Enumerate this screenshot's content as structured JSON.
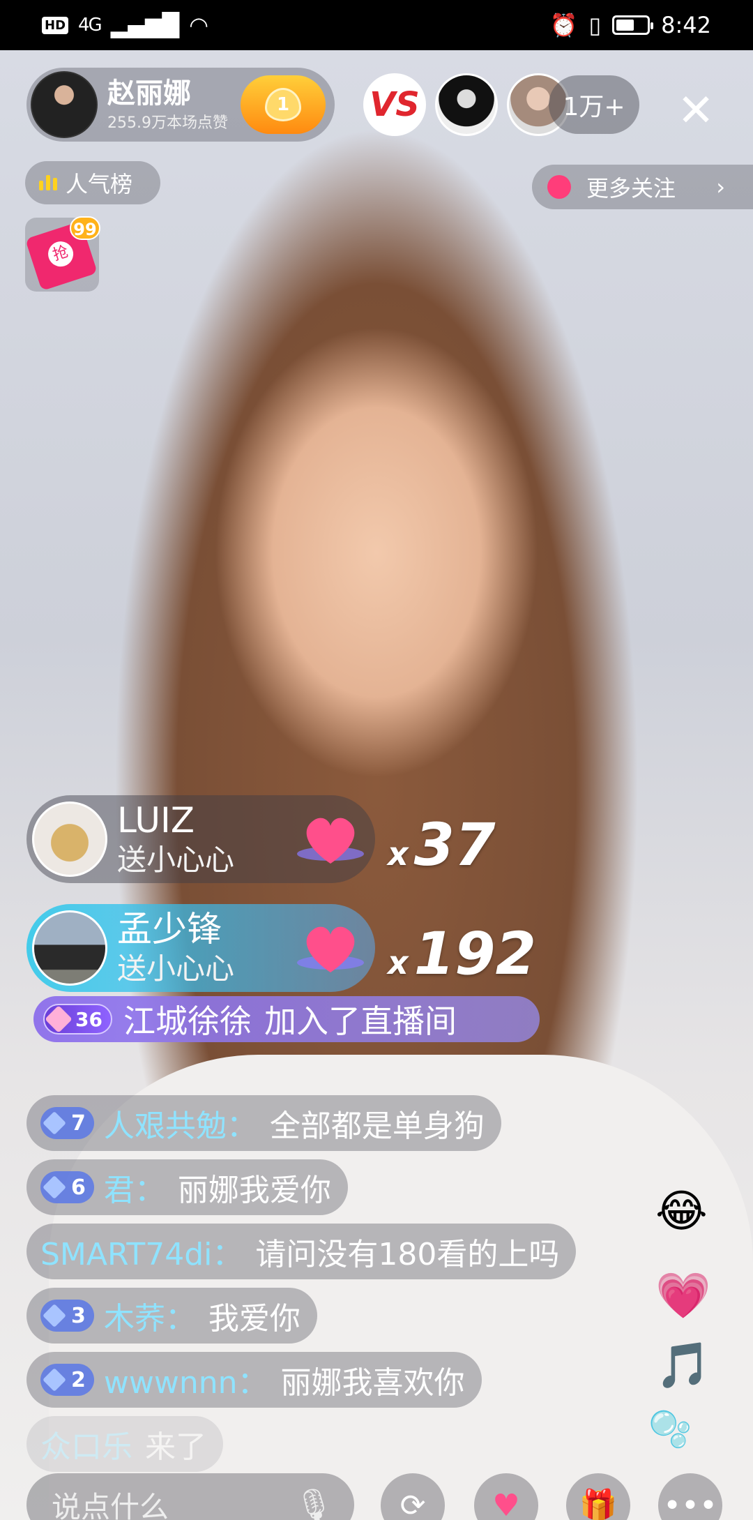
{
  "status_bar": {
    "hd": "HD",
    "network": "4G",
    "time": "8:42",
    "battery_level": 0.6
  },
  "host": {
    "name": "赵丽娜",
    "likes": "255.9万本场点赞",
    "follow_level": "1"
  },
  "viewers": {
    "vs_label": "VS",
    "count": "1万+"
  },
  "rank": {
    "label": "人气榜"
  },
  "more_follow": {
    "label": "更多关注"
  },
  "red_packet": {
    "badge": "99"
  },
  "gifts": [
    {
      "name": "LUIZ",
      "action": "送小心心",
      "x": "x",
      "count": "37"
    },
    {
      "name": "孟少锋",
      "action": "送小心心",
      "x": "x",
      "count": "192"
    }
  ],
  "join": {
    "level": "36",
    "user": "江城徐徐",
    "text": "加入了直播间"
  },
  "chat": [
    {
      "level": "7",
      "user": "人艰共勉：",
      "message": "全部都是单身狗"
    },
    {
      "level": "6",
      "user": "君：",
      "message": "丽娜我爱你"
    },
    {
      "level": "",
      "user": "SMART74di：",
      "message": "请问没有180看的上吗"
    },
    {
      "level": "3",
      "user": "木荞：",
      "message": "我爱你"
    },
    {
      "level": "2",
      "user": "wwwnnn：",
      "message": "丽娜我喜欢你"
    },
    {
      "level": "",
      "user": "众口乐",
      "message": "来了"
    }
  ],
  "input": {
    "placeholder": "说点什么"
  },
  "colors": {
    "gift_heart": "#ff4f8b",
    "chat_user": "#8fe3ff",
    "join_bg": "#8c6eeb"
  }
}
